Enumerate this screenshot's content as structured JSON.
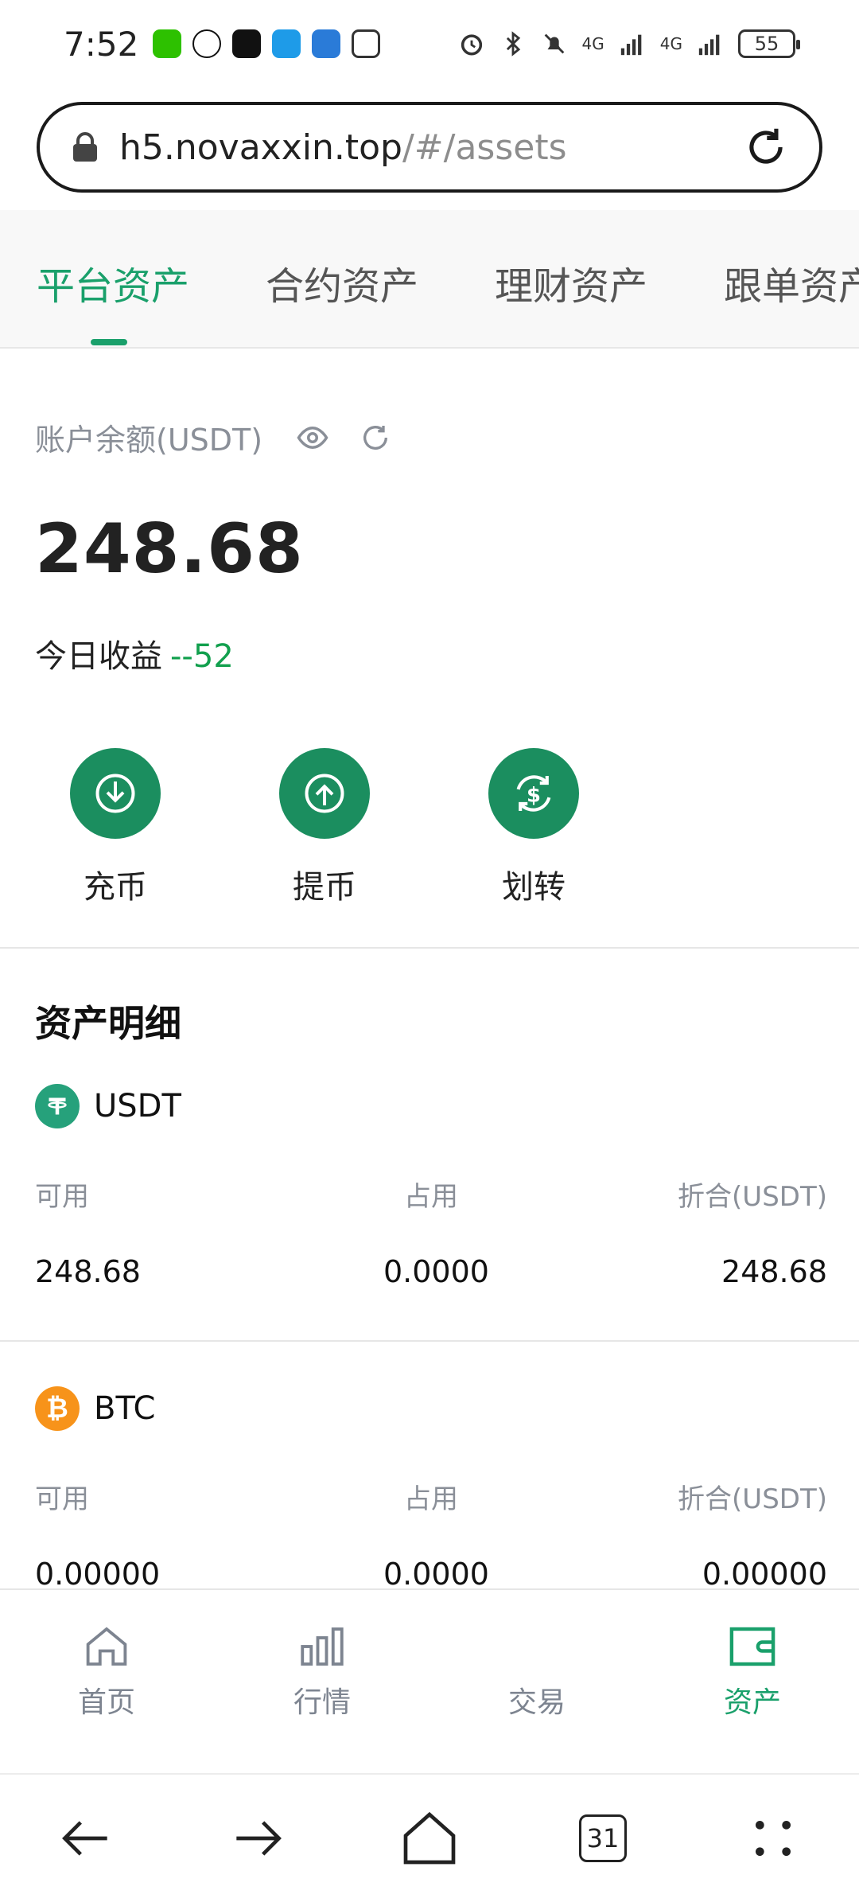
{
  "status_bar": {
    "time": "7:52",
    "battery": "55",
    "network_1": "4G",
    "network_2": "4G"
  },
  "url_bar": {
    "host": "h5.novaxxin.top",
    "path": "/#/assets"
  },
  "tabs": [
    {
      "label": "平台资产",
      "active": true
    },
    {
      "label": "合约资产",
      "active": false
    },
    {
      "label": "理财资产",
      "active": false
    },
    {
      "label": "跟单资产",
      "active": false
    }
  ],
  "balance": {
    "label": "账户余额(USDT)",
    "value": "248.68",
    "today_label": "今日收益",
    "today_value": "--52"
  },
  "actions": [
    {
      "label": "充币",
      "icon": "deposit-icon"
    },
    {
      "label": "提币",
      "icon": "withdraw-icon"
    },
    {
      "label": "划转",
      "icon": "transfer-icon"
    }
  ],
  "details": {
    "title": "资产明细",
    "columns": [
      "可用",
      "占用",
      "折合(USDT)"
    ],
    "assets": [
      {
        "name": "USDT",
        "available": "248.68",
        "occupied": "0.0000",
        "converted": "248.68",
        "color": "#26a17b"
      },
      {
        "name": "BTC",
        "available": "0.00000",
        "occupied": "0.0000",
        "converted": "0.00000",
        "color": "#f7931a"
      }
    ]
  },
  "bottom_nav": [
    {
      "label": "首页",
      "icon": "home-icon",
      "active": false
    },
    {
      "label": "行情",
      "icon": "chart-icon",
      "active": false
    },
    {
      "label": "交易",
      "icon": "trade-icon",
      "active": false
    },
    {
      "label": "资产",
      "icon": "wallet-icon",
      "active": true
    }
  ],
  "browser_bar": {
    "tab_count": "31"
  },
  "colors": {
    "accent": "#1aa06b",
    "action_green": "#1b8e5f",
    "profit_green": "#12a04e"
  }
}
